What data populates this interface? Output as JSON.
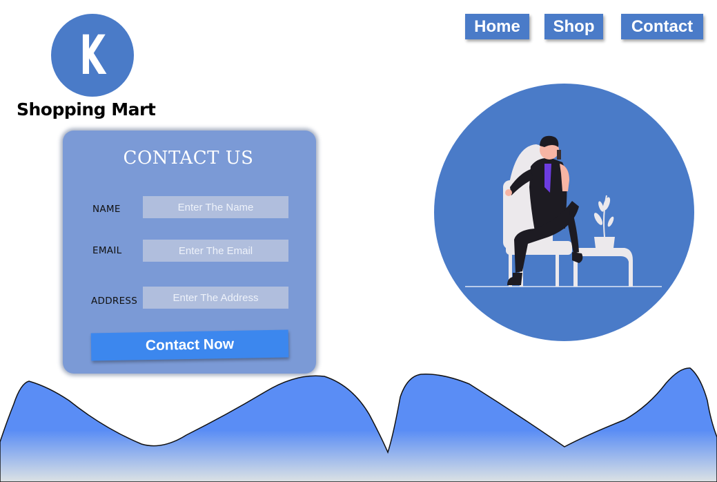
{
  "brand": {
    "logo_letter": "K",
    "name": "Shopping Mart"
  },
  "nav": {
    "items": [
      "Home",
      "Shop",
      "Contact"
    ]
  },
  "contact_form": {
    "title": "CONTACT US",
    "fields": [
      {
        "label": "NAME",
        "placeholder": "Enter The Name"
      },
      {
        "label": "EMAIL",
        "placeholder": "Enter The Email"
      },
      {
        "label": "ADDRESS",
        "placeholder": "Enter The Address"
      }
    ],
    "submit_label": "Contact Now"
  },
  "colors": {
    "primary_blue": "#4a7bc8",
    "card_blue": "#7b9ad6",
    "input_bg": "#b0bedd",
    "button_blue": "#3c87ee",
    "wave_blue": "#5a8df5",
    "person_shirt": "#6c3ce0"
  }
}
